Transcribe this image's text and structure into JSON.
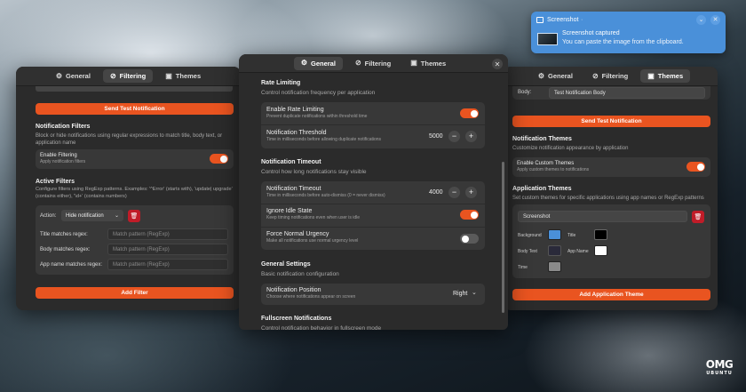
{
  "tabs": {
    "general": "General",
    "filtering": "Filtering",
    "themes": "Themes"
  },
  "icons": {
    "general": "gear-icon",
    "filtering": "filter-icon",
    "themes": "image-icon",
    "close": "close-icon",
    "trash": "trash-icon",
    "minimize": "chevron-down-icon"
  },
  "colors": {
    "accent": "#e95420",
    "window_bg": "#2b2b2b",
    "card_bg": "#383838",
    "danger": "#c01c28",
    "notification_bg": "#4a90d9"
  },
  "notification": {
    "app": "Screenshot",
    "title": "Screenshot captured",
    "body": "You can paste the image from the clipboard."
  },
  "left": {
    "send_test_label": "Send Test Notification",
    "filters_title": "Notification Filters",
    "filters_desc": "Block or hide notifications using regular expressions to match title, body text, or application name",
    "enable_filtering_title": "Enable Filtering",
    "enable_filtering_sub": "Apply notification filters",
    "active_filters_title": "Active Filters",
    "active_filters_desc": "Configure filters using RegExp patterns. Examples: '^Error' (starts with), 'update| upgrade' (contains either), '\\d+' (contains numbers)",
    "action_label": "Action:",
    "action_value": "Hide notification",
    "title_regex_label": "Title matches regex:",
    "body_regex_label": "Body matches regex:",
    "app_regex_label": "App name matches regex:",
    "regex_placeholder": "Match pattern (RegExp)",
    "add_filter_label": "Add Filter"
  },
  "center": {
    "rate_title": "Rate Limiting",
    "rate_desc": "Control notification frequency per application",
    "enable_rate_title": "Enable Rate Limiting",
    "enable_rate_sub": "Prevent duplicate notifications within threshold time",
    "threshold_title": "Notification Threshold",
    "threshold_sub": "Time in milliseconds before allowing duplicate notifications",
    "threshold_value": "5000",
    "timeout_title": "Notification Timeout",
    "timeout_desc": "Control how long notifications stay visible",
    "timeout_row_title": "Notification Timeout",
    "timeout_row_sub": "Time in milliseconds before auto-dismiss (0 = never dismiss)",
    "timeout_value": "4000",
    "ignore_idle_title": "Ignore Idle State",
    "ignore_idle_sub": "Keep timing notifications even when user is idle",
    "force_normal_title": "Force Normal Urgency",
    "force_normal_sub": "Make all notifications use normal urgency level",
    "general_title": "General Settings",
    "general_desc": "Basic notification configuration",
    "position_title": "Notification Position",
    "position_sub": "Choose where notifications appear on screen",
    "position_value": "Right",
    "fullscreen_title": "Fullscreen Notifications",
    "fullscreen_desc": "Control notification behavior in fullscreen mode"
  },
  "right": {
    "body_label": "Body:",
    "body_value": "Test Notification Body",
    "send_test_label": "Send Test Notification",
    "themes_title": "Notification Themes",
    "themes_desc": "Customize notification appearance by application",
    "enable_custom_title": "Enable Custom Themes",
    "enable_custom_sub": "Apply custom themes to notifications",
    "app_themes_title": "Application Themes",
    "app_themes_desc": "Set custom themes for specific applications using app names or RegExp patterns",
    "app_name_value": "Screenshot",
    "background_label": "Background",
    "title_label": "Title",
    "body_text_label": "Body Text",
    "app_name_label": "App Name",
    "time_label": "Time",
    "swatch_background": "#4a90d9",
    "swatch_title": "#000000",
    "swatch_body_text": "#2a2a3a",
    "swatch_app_name": "#ffffff",
    "swatch_time": "#8a8a8a",
    "add_theme_label": "Add Application Theme"
  },
  "logo": {
    "line1": "OMG",
    "line2": "UBUNTU"
  }
}
